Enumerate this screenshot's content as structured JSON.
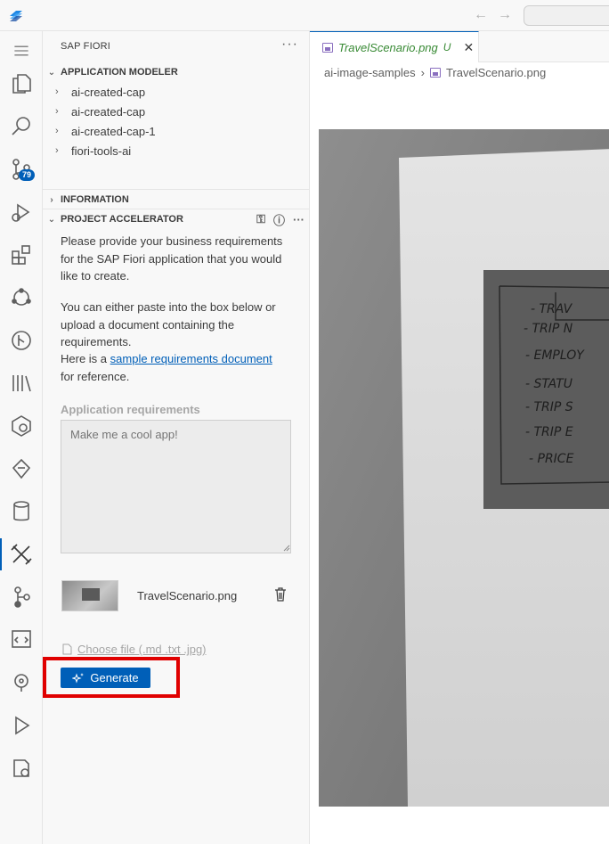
{
  "sidebar": {
    "title": "SAP FIORI",
    "more": "···",
    "source_control_badge": "79",
    "app_modeler": {
      "heading": "APPLICATION MODELER",
      "items": [
        "ai-created-cap",
        "ai-created-cap",
        "ai-created-cap-1",
        "fiori-tools-ai"
      ]
    },
    "information": {
      "heading": "INFORMATION"
    },
    "project_accelerator": {
      "heading": "PROJECT ACCELERATOR",
      "intro": "Please provide your business requirements for the SAP Fiori application that you would like to create.",
      "paste_text": "You can either paste into the box below or upload a document containing the requirements.",
      "here_is": "Here is a",
      "link_text": "sample requirements document",
      "for_reference": "for reference.",
      "field_label": "Application requirements",
      "placeholder": "Make me a cool app!",
      "attached_file": "TravelScenario.png",
      "choose_file": "Choose file (.md .txt .jpg)",
      "generate_label": "Generate"
    }
  },
  "editor": {
    "tab_name": "TravelScenario.png",
    "tab_status": "U",
    "breadcrumb_folder": "ai-image-samples",
    "breadcrumb_file": "TravelScenario.png"
  },
  "colors": {
    "accent": "#005fb8",
    "highlight": "#e00000",
    "untracked": "#388a34"
  }
}
